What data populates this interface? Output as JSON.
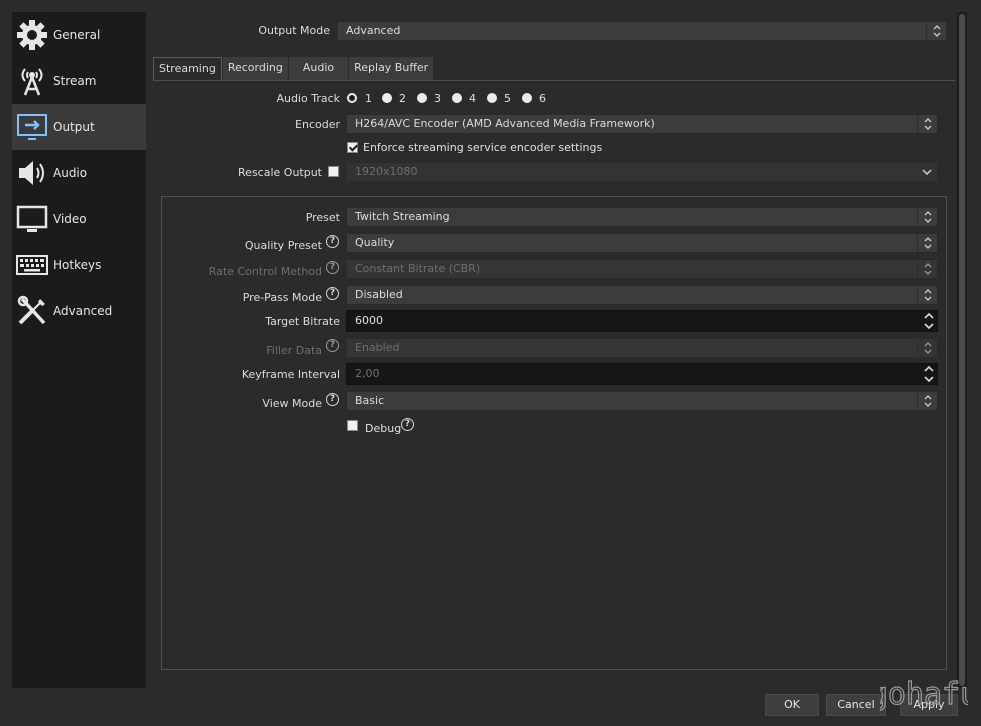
{
  "sidebar": {
    "items": [
      {
        "label": "General",
        "icon": "gear-icon"
      },
      {
        "label": "Stream",
        "icon": "broadcast-tower-icon"
      },
      {
        "label": "Output",
        "icon": "output-monitor-icon"
      },
      {
        "label": "Audio",
        "icon": "speaker-icon"
      },
      {
        "label": "Video",
        "icon": "monitor-icon"
      },
      {
        "label": "Hotkeys",
        "icon": "keyboard-icon"
      },
      {
        "label": "Advanced",
        "icon": "tools-icon"
      }
    ],
    "active": "Output"
  },
  "output_mode": {
    "label": "Output Mode",
    "value": "Advanced"
  },
  "tabs": [
    {
      "label": "Streaming",
      "active": true
    },
    {
      "label": "Recording"
    },
    {
      "label": "Audio"
    },
    {
      "label": "Replay Buffer"
    }
  ],
  "audio_track": {
    "label": "Audio Track",
    "options": [
      "1",
      "2",
      "3",
      "4",
      "5",
      "6"
    ],
    "selected": "1"
  },
  "encoder": {
    "label": "Encoder",
    "value": "H264/AVC Encoder (AMD Advanced Media Framework)"
  },
  "enforce": {
    "label": "Enforce streaming service encoder settings",
    "checked": true
  },
  "rescale": {
    "label": "Rescale Output",
    "value": "1920x1080",
    "checked": false
  },
  "encoder_settings": {
    "preset": {
      "label": "Preset",
      "value": "Twitch Streaming"
    },
    "quality_preset": {
      "label": "Quality Preset",
      "value": "Quality"
    },
    "rate_control": {
      "label": "Rate Control Method",
      "value": "Constant Bitrate (CBR)"
    },
    "prepass": {
      "label": "Pre-Pass Mode",
      "value": "Disabled"
    },
    "target_bitrate": {
      "label": "Target Bitrate",
      "value": "6000"
    },
    "filler_data": {
      "label": "Filler Data",
      "value": "Enabled"
    },
    "keyframe": {
      "label": "Keyframe Interval",
      "value": "2,00"
    },
    "view_mode": {
      "label": "View Mode",
      "value": "Basic"
    },
    "debug": {
      "label": "Debug",
      "checked": false
    }
  },
  "help_glyph": "?",
  "buttons": {
    "ok": "OK",
    "cancel": "Cancel",
    "apply": "Apply"
  },
  "watermark_text": "gohafu"
}
